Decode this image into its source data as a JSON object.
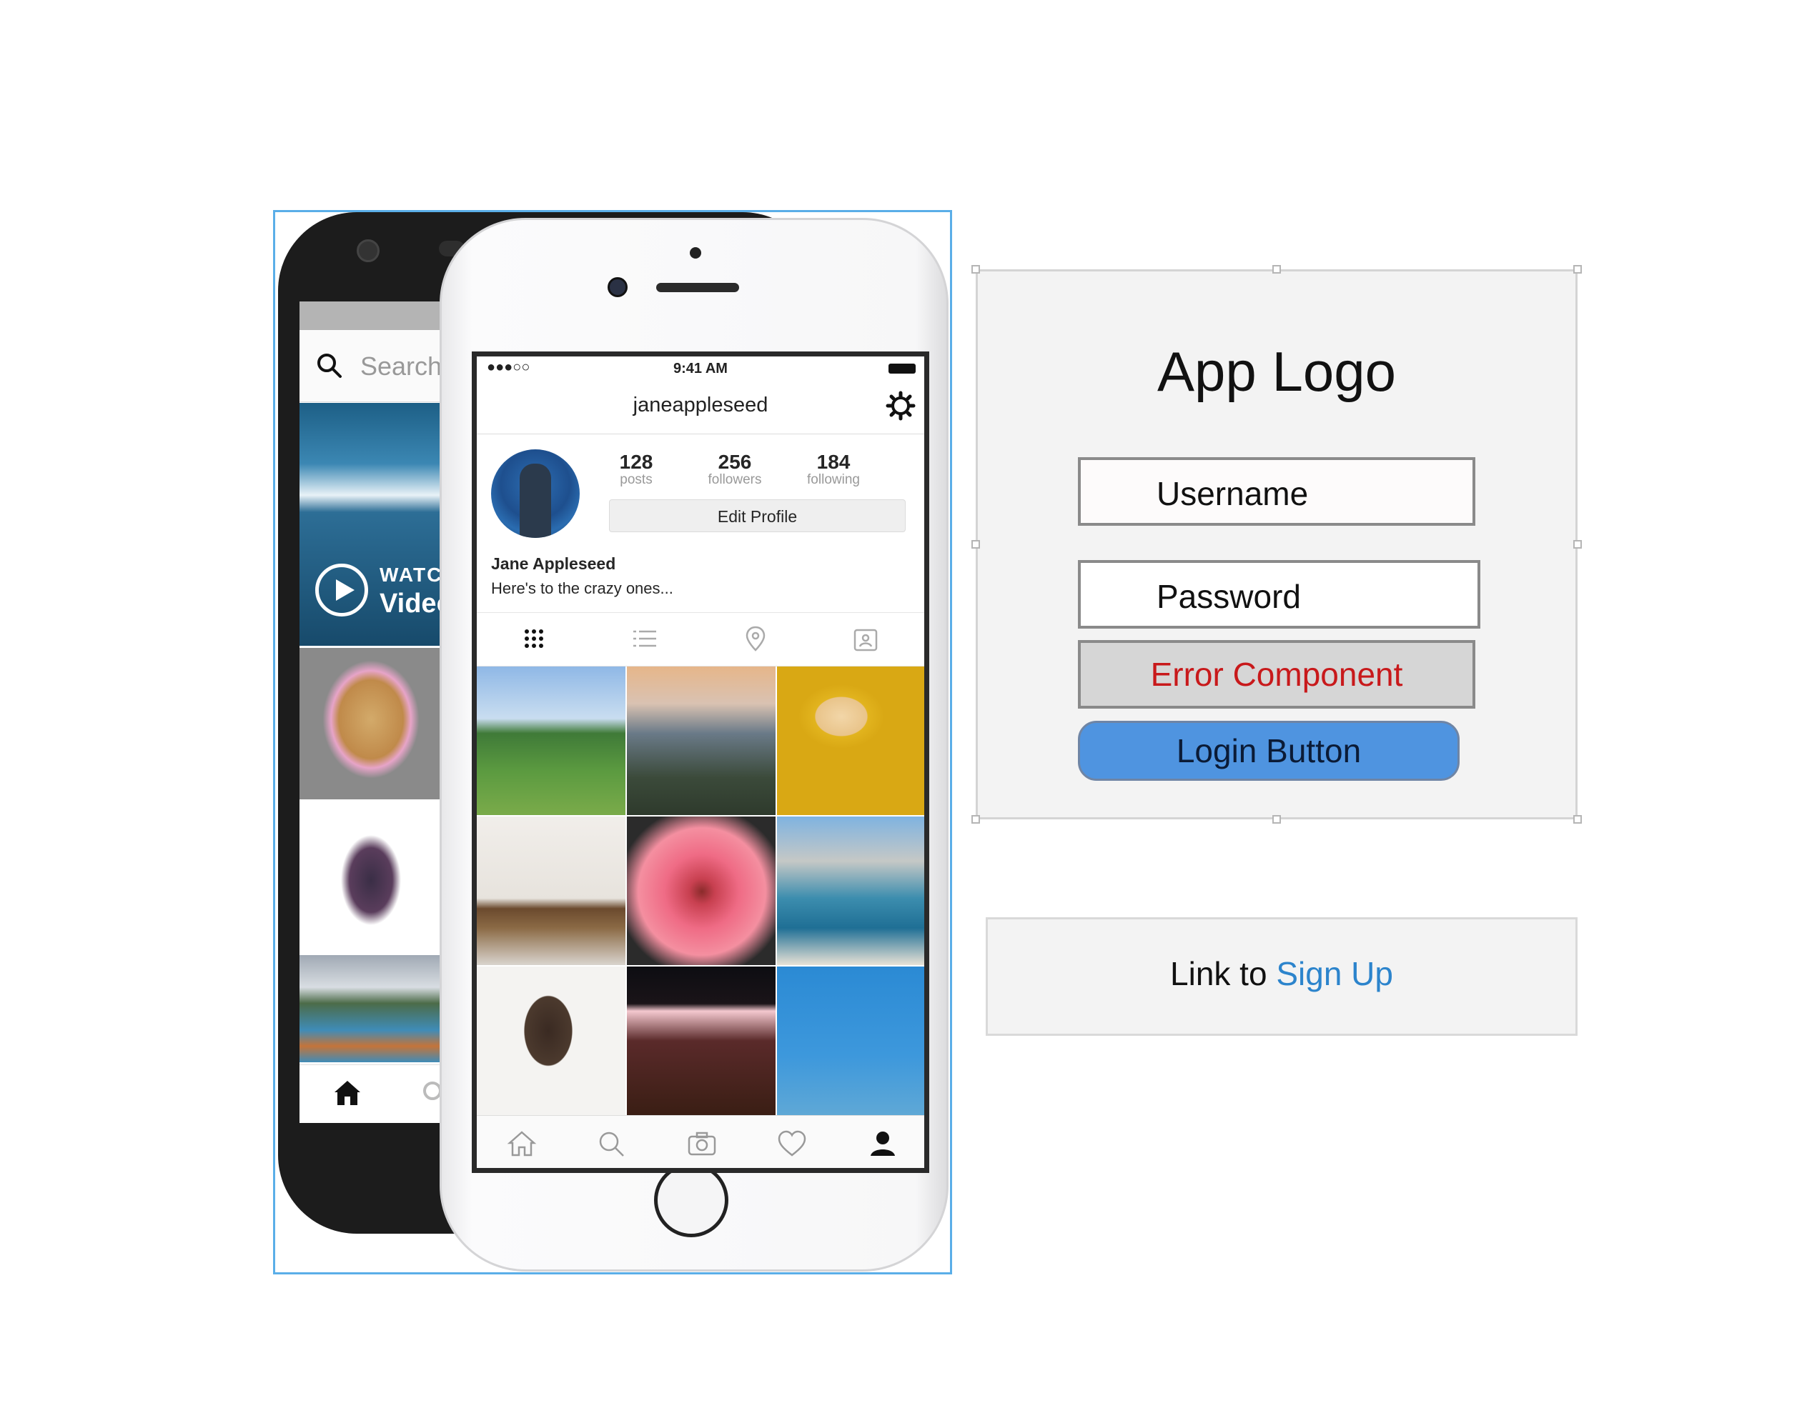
{
  "phone_mockup": {
    "back_phone": {
      "search_placeholder": "Search",
      "video_label_top": "WATCH",
      "video_label_bottom": "Video"
    },
    "front_phone": {
      "status": {
        "time": "9:41 AM",
        "signal": "●●●○○"
      },
      "header": {
        "username": "janeappleseed"
      },
      "stats": [
        {
          "value": "128",
          "label": "posts"
        },
        {
          "value": "256",
          "label": "followers"
        },
        {
          "value": "184",
          "label": "following"
        }
      ],
      "edit_profile_label": "Edit Profile",
      "bio": {
        "name": "Jane Appleseed",
        "text": "Here's to the crazy ones..."
      },
      "view_tabs": [
        "grid-icon",
        "list-icon",
        "location-pin-icon",
        "tagged-photos-icon"
      ],
      "tab_bar": [
        "home-icon",
        "search-icon",
        "camera-icon",
        "heart-icon",
        "profile-icon"
      ]
    }
  },
  "wireframe": {
    "app_logo": "App Logo",
    "username_field": "Username",
    "password_field": "Password",
    "error_component": "Error Component",
    "login_button": "Login Button",
    "signup": {
      "prefix": "Link to ",
      "link": "Sign Up"
    }
  },
  "colors": {
    "selection_border": "#5aaee8",
    "error_text": "#c8191b",
    "login_button_bg": "#4f94e0",
    "signup_link": "#2c84cc"
  }
}
